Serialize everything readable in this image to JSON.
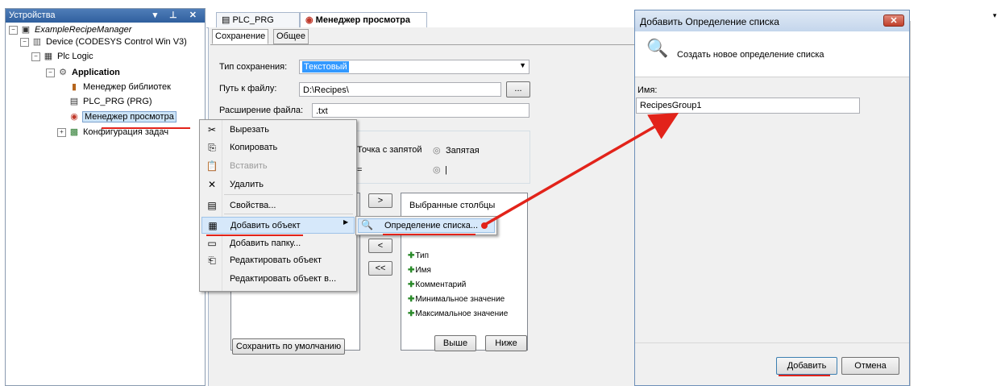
{
  "devices": {
    "title": "Устройства",
    "header_buttons": "▾ ⊥ ✕",
    "tree": [
      {
        "label": "ExampleRecipeManager",
        "exp": "−",
        "icon": "project-icon"
      },
      {
        "label": "Device (CODESYS Control Win V3)",
        "exp": "−",
        "icon": "device-icon"
      },
      {
        "label": "Plc Logic",
        "exp": "−",
        "icon": "plc-logic-icon"
      },
      {
        "label": "Application",
        "exp": "−",
        "icon": "application-gear-icon"
      },
      {
        "label": "Менеджер библиотек",
        "icon": "library-books-icon"
      },
      {
        "label": "PLC_PRG (PRG)",
        "icon": "program-icon"
      },
      {
        "label": "Менеджер просмотра",
        "icon": "recipe-manager-icon"
      },
      {
        "label": "Конфигурация задач",
        "exp": "+",
        "icon": "task-config-icon"
      }
    ]
  },
  "editor": {
    "tabs": [
      {
        "label": "PLC_PRG",
        "icon": "program-icon"
      },
      {
        "label": "Менеджер просмотра",
        "icon": "recipe-manager-icon",
        "close": "✕"
      }
    ],
    "subtabs": [
      "Сохранение",
      "Общее"
    ],
    "save_type_label": "Тип сохранения:",
    "save_type_value": "Текстовый",
    "path_label": "Путь к файлу:",
    "path_value": "D:\\Recipes\\",
    "browse_label": "...",
    "ext_label": "Расширение файла:",
    "ext_value": ".txt",
    "radio_semicolon": "Точка с запятой",
    "radio_comma": "Запятая",
    "eq_label": "=",
    "radio_pipe": "|",
    "btn_add_col": ">",
    "btn_remove_col": "<",
    "btn_remove_all": "<<",
    "selected_columns_title": "Выбранные столбцы",
    "selected_columns": [
      "Тип",
      "Имя",
      "Комментарий",
      "Минимальное значение",
      "Максимальное значение"
    ],
    "save_default_label": "Сохранить по умолчанию",
    "up_label": "Выше",
    "down_label": "Ниже"
  },
  "context_menu": {
    "items": [
      {
        "label": "Вырезать",
        "icon": "scissors-icon",
        "glyph": "✂"
      },
      {
        "label": "Копировать",
        "icon": "copy-icon",
        "glyph": "⎘"
      },
      {
        "label": "Вставить",
        "icon": "paste-icon",
        "glyph": "📋",
        "disabled": true
      },
      {
        "label": "Удалить",
        "icon": "delete-icon",
        "glyph": "✕"
      },
      {
        "label": "Свойства...",
        "icon": "properties-icon",
        "glyph": "▤"
      },
      {
        "label": "Добавить объект",
        "icon": "add-object-icon",
        "glyph": "▦",
        "submenu": true
      },
      {
        "label": "Добавить папку...",
        "icon": "folder-icon",
        "glyph": "▭"
      },
      {
        "label": "Редактировать объект",
        "icon": "edit-object-icon",
        "glyph": "⎗"
      },
      {
        "label": "Редактировать объект в...",
        "icon": "",
        "glyph": ""
      }
    ],
    "submenu_item": "Определение списка..."
  },
  "dialog": {
    "title": "Добавить Определение списка",
    "close_label": "✕",
    "header_text": "Создать новое определение списка",
    "name_label": "Имя:",
    "name_value": "RecipesGroup1",
    "add_label": "Добавить",
    "cancel_label": "Отмена"
  },
  "colors": {
    "accent_red": "#e2231a",
    "selection_blue": "#3399ff",
    "titlebar_blue": "#2f5f9e"
  }
}
